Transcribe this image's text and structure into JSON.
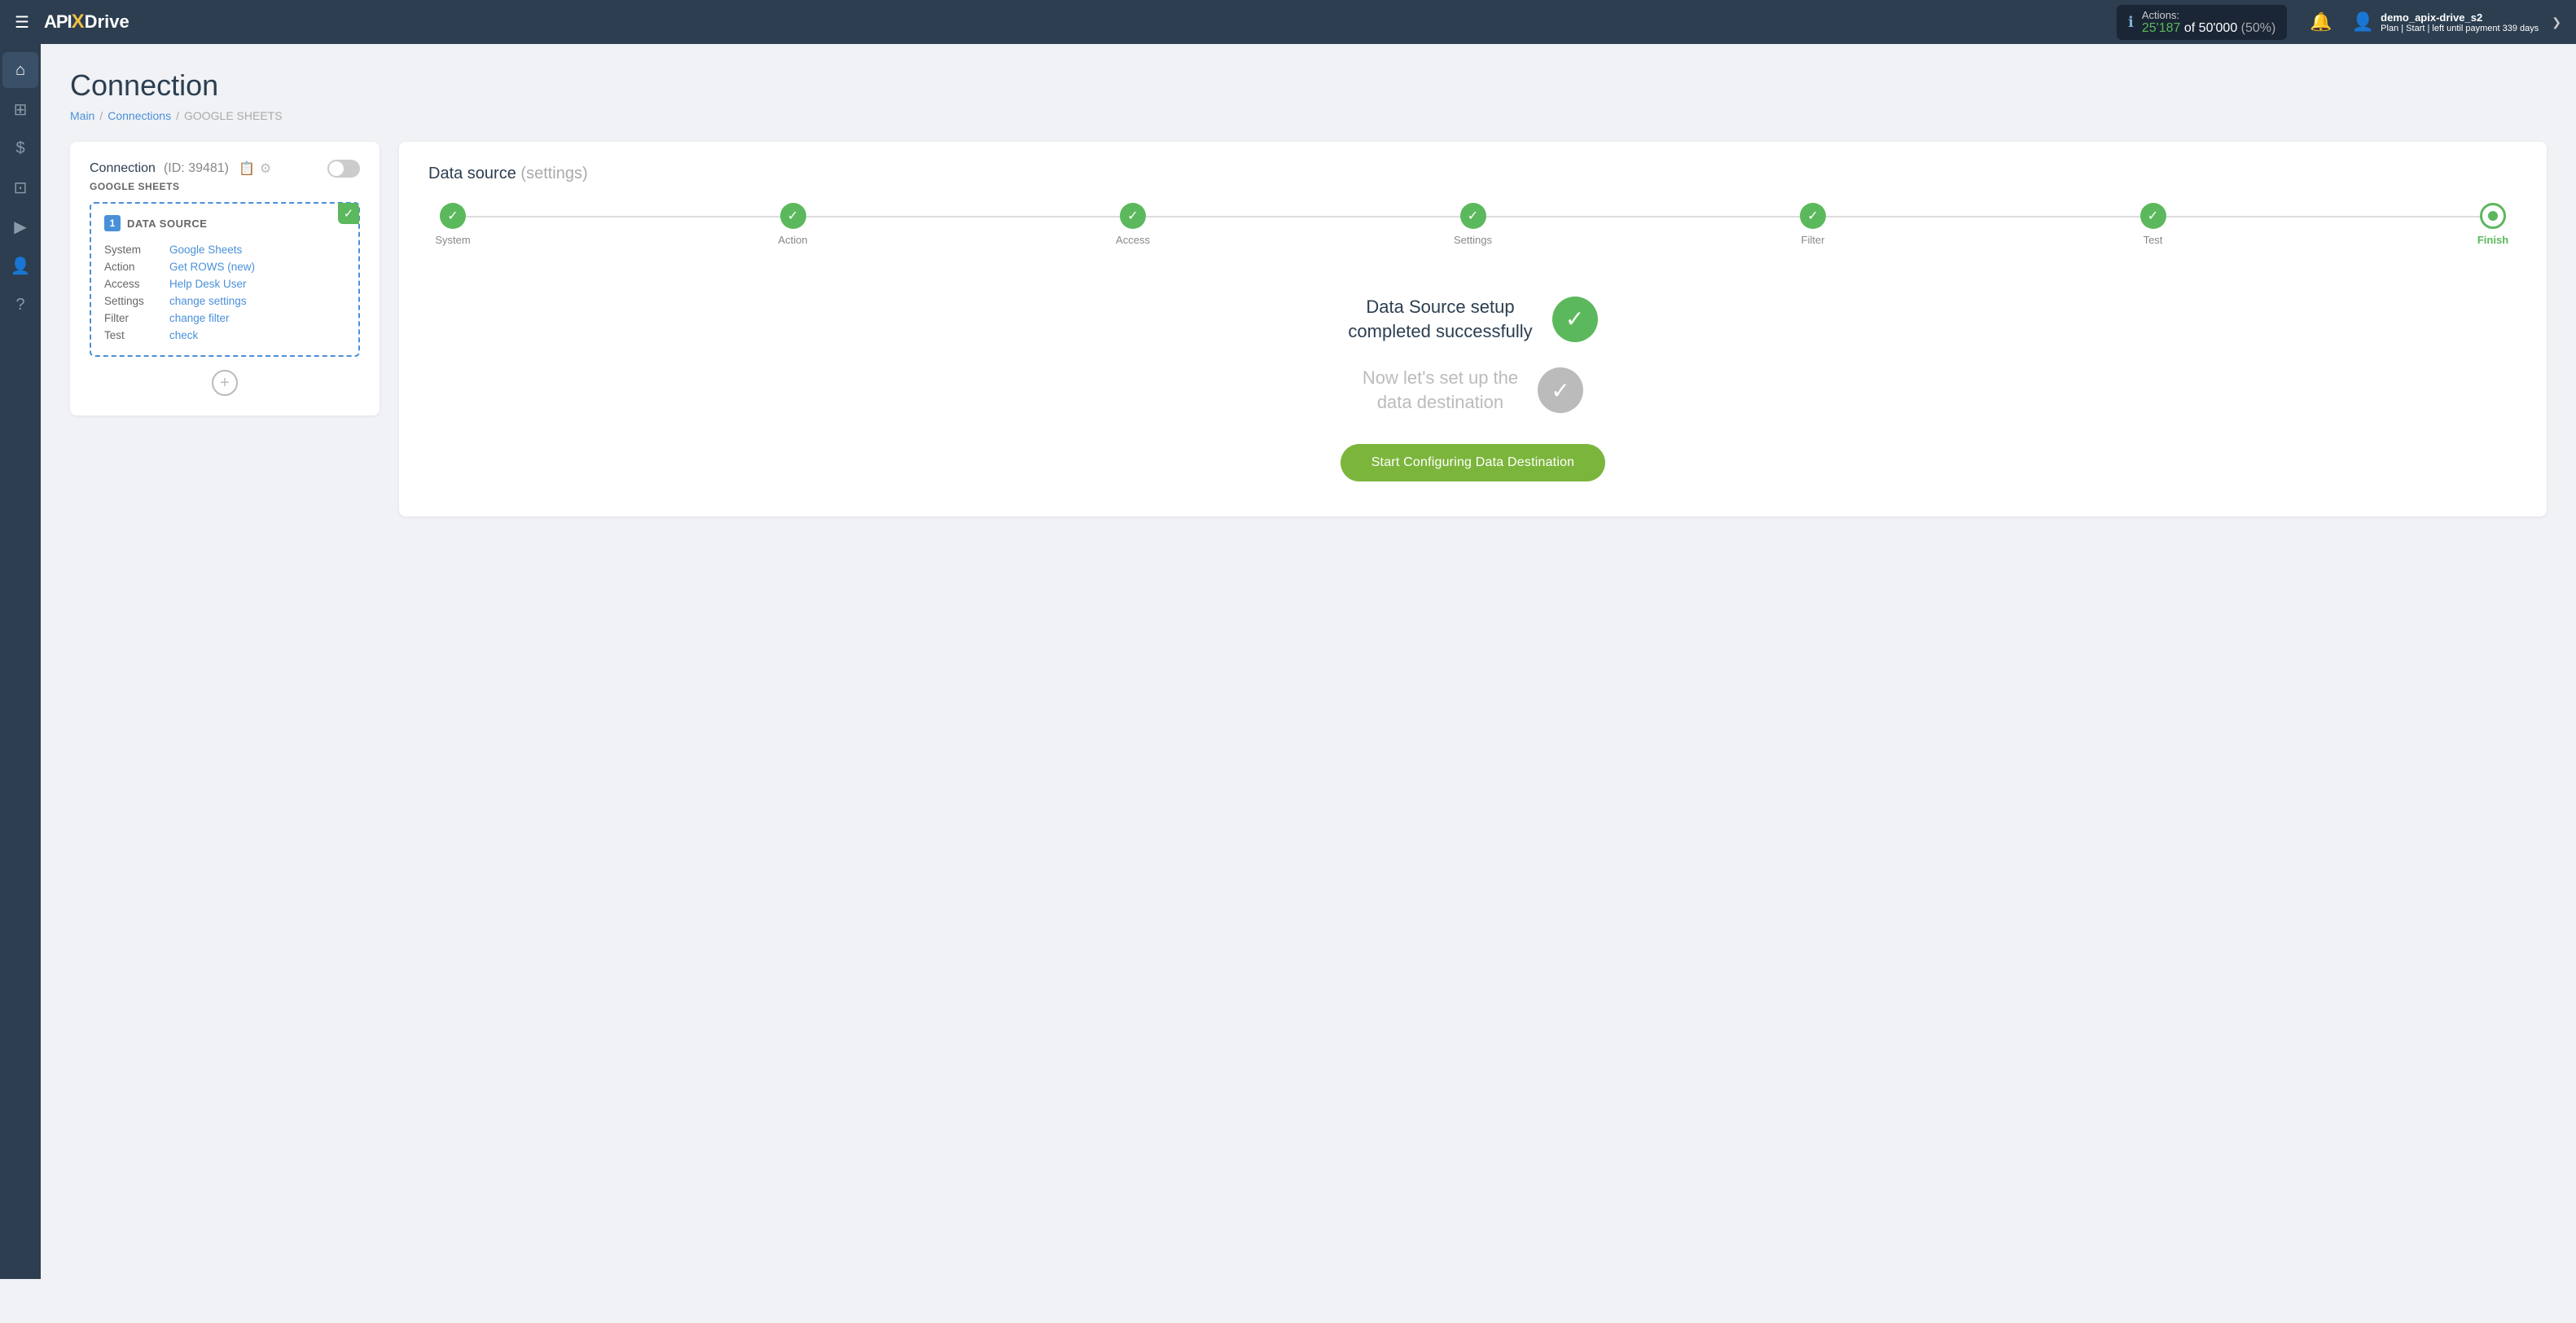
{
  "topnav": {
    "hamburger": "☰",
    "logo": {
      "api": "API",
      "x": "X",
      "drive": "Drive"
    },
    "actions": {
      "label": "Actions:",
      "current": "25'187",
      "total": "50'000",
      "percent": "50%"
    },
    "user": {
      "name": "demo_apix-drive_s2",
      "plan_label": "Plan |",
      "plan_type": "Start",
      "payment_label": "| left until payment",
      "days": "339 days"
    },
    "chevron": "❯"
  },
  "sidebar": {
    "items": [
      {
        "icon": "⌂",
        "label": "home-icon"
      },
      {
        "icon": "⊞",
        "label": "grid-icon"
      },
      {
        "icon": "$",
        "label": "billing-icon"
      },
      {
        "icon": "⊡",
        "label": "briefcase-icon"
      },
      {
        "icon": "▶",
        "label": "play-icon"
      },
      {
        "icon": "👤",
        "label": "user-icon"
      },
      {
        "icon": "?",
        "label": "help-icon"
      }
    ]
  },
  "page": {
    "title": "Connection",
    "breadcrumb": {
      "main": "Main",
      "connections": "Connections",
      "current": "GOOGLE SHEETS"
    }
  },
  "left_card": {
    "title": "Connection",
    "id": "(ID: 39481)",
    "subtitle": "GOOGLE SHEETS",
    "datasource": {
      "number": "1",
      "label": "DATA SOURCE",
      "rows": [
        {
          "key": "System",
          "value": "Google Sheets",
          "is_link": true
        },
        {
          "key": "Action",
          "value": "Get ROWS (new)",
          "is_link": true
        },
        {
          "key": "Access",
          "value": "Help Desk User",
          "is_link": true
        },
        {
          "key": "Settings",
          "value": "change settings",
          "is_link": true
        },
        {
          "key": "Filter",
          "value": "change filter",
          "is_link": true
        },
        {
          "key": "Test",
          "value": "check",
          "is_link": true
        }
      ]
    },
    "add_label": "+"
  },
  "right_card": {
    "title": "Data source",
    "title_paren": "(settings)",
    "steps": [
      {
        "label": "System",
        "done": true,
        "active": false
      },
      {
        "label": "Action",
        "done": true,
        "active": false
      },
      {
        "label": "Access",
        "done": true,
        "active": false
      },
      {
        "label": "Settings",
        "done": true,
        "active": false
      },
      {
        "label": "Filter",
        "done": true,
        "active": false
      },
      {
        "label": "Test",
        "done": true,
        "active": false
      },
      {
        "label": "Finish",
        "done": false,
        "active": true,
        "finish": true
      }
    ],
    "success_message": "Data Source setup\ncompleted successfully",
    "next_message": "Now let's set up the\ndata destination",
    "cta_button": "Start Configuring Data Destination"
  }
}
